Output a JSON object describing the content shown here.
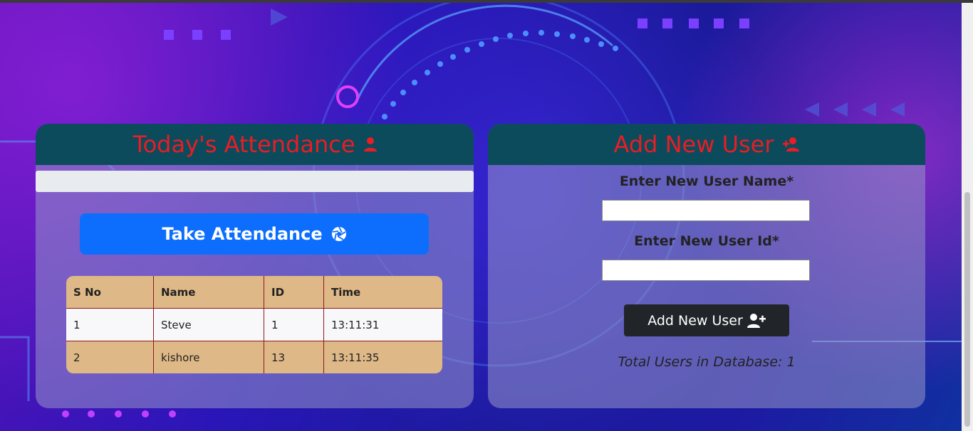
{
  "attendance": {
    "title": "Today's Attendance",
    "take_button": "Take Attendance",
    "columns": [
      "S No",
      "Name",
      "ID",
      "Time"
    ],
    "rows": [
      [
        "1",
        "Steve",
        "1",
        "13:11:31"
      ],
      [
        "2",
        "kishore",
        "13",
        "13:11:35"
      ]
    ]
  },
  "add_user": {
    "title": "Add New User",
    "name_label": "Enter New User Name*",
    "id_label": "Enter New User Id*",
    "name_value": "",
    "id_value": "",
    "button": "Add New User",
    "total": "Total Users in Database: 1"
  },
  "colors": {
    "header_bg": "#0b4b5c",
    "header_text": "#e81d25",
    "primary_button": "#0d6efd",
    "dark_button": "#212529",
    "table_accent": "#deb887"
  },
  "icons": {
    "attendance": "user-icon",
    "take": "camera-shutter-icon",
    "add_user_header": "user-plus-icon",
    "add_user_button": "user-plus-icon"
  }
}
